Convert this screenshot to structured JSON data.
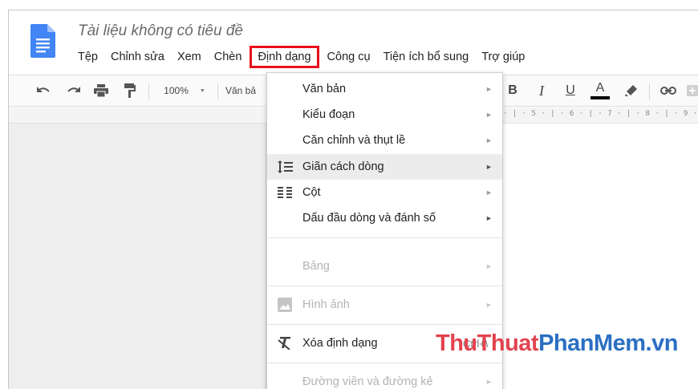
{
  "document": {
    "title": "Tài liệu không có tiêu đề"
  },
  "menubar": {
    "items": [
      "Tệp",
      "Chỉnh sửa",
      "Xem",
      "Chèn",
      "Định dạng",
      "Công cụ",
      "Tiện ích bổ sung",
      "Trợ giúp"
    ],
    "active": "Định dạng",
    "highlight_color": "#e8101a"
  },
  "toolbar": {
    "zoom": "100%",
    "style": "Văn bả"
  },
  "ruler": {
    "text": "· | · 5 · | · 6 · | · 7 · | · 8 · | · 9 ·"
  },
  "format_menu": {
    "items": [
      {
        "label": "Văn bản",
        "icon": null,
        "submenu": true,
        "enabled": true
      },
      {
        "label": "Kiểu đoạn",
        "icon": null,
        "submenu": true,
        "enabled": true
      },
      {
        "label": "Căn chỉnh và thụt lề",
        "icon": null,
        "submenu": true,
        "enabled": true
      },
      {
        "label": "Giãn cách dòng",
        "icon": "line-spacing-icon",
        "submenu": true,
        "enabled": true,
        "highlighted": true
      },
      {
        "label": "Cột",
        "icon": "columns-icon",
        "submenu": true,
        "enabled": true
      },
      {
        "label": "Dấu đầu dòng và đánh số",
        "icon": null,
        "submenu": true,
        "enabled": true
      },
      {
        "label": "Bảng",
        "icon": null,
        "submenu": true,
        "enabled": false
      },
      {
        "label": "Hình ảnh",
        "icon": "image-icon",
        "submenu": true,
        "enabled": false
      },
      {
        "label": "Xóa định dạng",
        "icon": "clear-formatting-icon",
        "submenu": false,
        "enabled": true,
        "shortcut": "Ctrl+\\"
      },
      {
        "label": "Đường viền và đường kẻ",
        "icon": null,
        "submenu": true,
        "enabled": false
      }
    ],
    "arrow": "►"
  },
  "watermark": {
    "part1": "ThuThuat",
    "part2": "PhanMem.vn"
  }
}
